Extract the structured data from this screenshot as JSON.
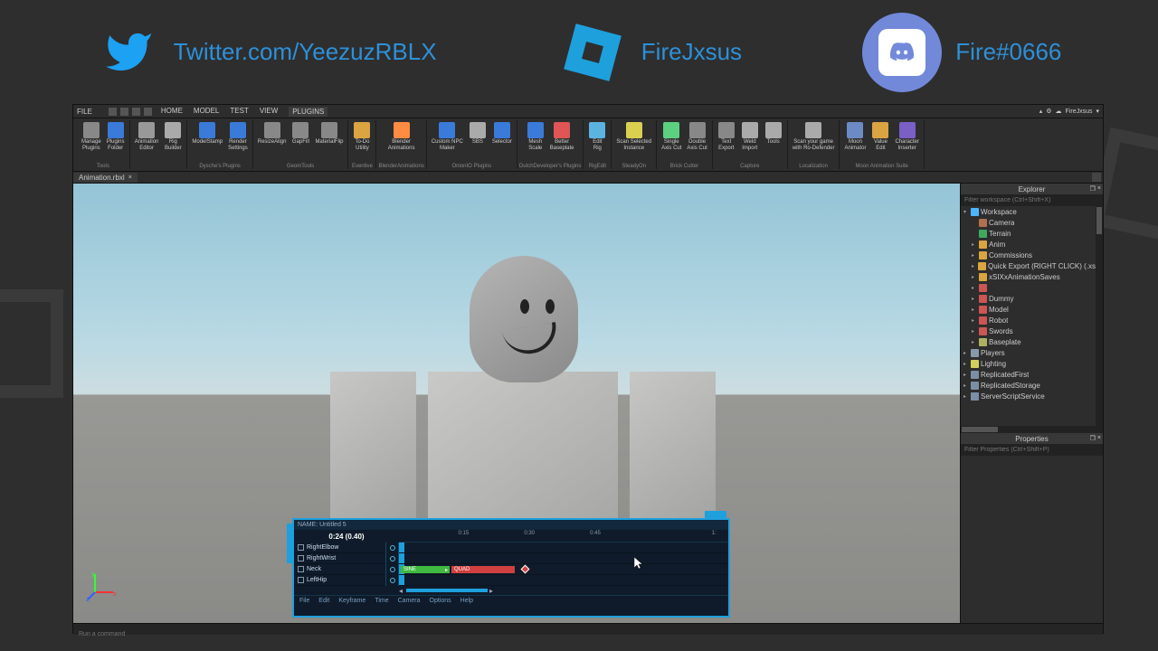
{
  "banner": {
    "twitter": "Twitter.com/YeezuzRBLX",
    "brand": "FireJxsus",
    "discord": "Fire#0666"
  },
  "menubar": {
    "file": "FILE",
    "tabs": [
      "HOME",
      "MODEL",
      "TEST",
      "VIEW",
      "PLUGINS"
    ],
    "user": "FireJxsus"
  },
  "ribbon": [
    {
      "group": "Tools",
      "items": [
        "Manage\nPlugins",
        "Plugins\nFolder"
      ]
    },
    {
      "group": "",
      "items": [
        "Animation\nEditor",
        "Rig\nBuilder"
      ]
    },
    {
      "group": "Dysche's Plugins",
      "items": [
        "ModelStamp",
        "Render\nSettings"
      ]
    },
    {
      "group": "GeomTools",
      "items": [
        "ResizeAlign",
        "GapFill",
        "MaterialFlip"
      ]
    },
    {
      "group": "Eventive",
      "items": [
        "To-Do\nUtility"
      ]
    },
    {
      "group": "BlenderAnimations",
      "items": [
        "Blender\nAnimations"
      ]
    },
    {
      "group": "OnionIO Plugins",
      "items": [
        "Custom NPC\nMaker",
        "SBS",
        "Selector"
      ]
    },
    {
      "group": "DutchDeveloper's Plugins",
      "items": [
        "Mesh\nScale",
        "Better\nBaseplate"
      ]
    },
    {
      "group": "RigEdit",
      "items": [
        "Edit\nRig"
      ]
    },
    {
      "group": "SteadyOn",
      "items": [
        "Scan Selected\nInstance"
      ]
    },
    {
      "group": "Brick Cutter",
      "items": [
        "Single\nAxis Cut",
        "Double\nAxis Cut"
      ]
    },
    {
      "group": "Capture",
      "items": [
        "Text\nExport",
        "Weld\nImport",
        "Tools"
      ]
    },
    {
      "group": "Localization",
      "items": [
        "Scan your game\nwith Ro-Defender"
      ]
    },
    {
      "group": "Moon Animation Suite",
      "items": [
        "Moon\nAnimator",
        "Value\nEdit",
        "Character\nInserter"
      ]
    }
  ],
  "document": {
    "tab": "Animation.rbxl"
  },
  "explorer": {
    "title": "Explorer",
    "filter_placeholder": "Filter workspace (Ctrl+Shift+X)",
    "tree": [
      {
        "label": "Workspace",
        "color": "#4fb4ff",
        "indent": 0,
        "arrow": "▾"
      },
      {
        "label": "Camera",
        "color": "#b07050",
        "indent": 1
      },
      {
        "label": "Terrain",
        "color": "#41a85f",
        "indent": 1
      },
      {
        "label": "Anim",
        "color": "#d9a441",
        "indent": 1,
        "arrow": "▸"
      },
      {
        "label": "Commissions",
        "color": "#d9a441",
        "indent": 1,
        "arrow": "▸"
      },
      {
        "label": "Quick Export (RIGHT CLICK) (.xslva FILE)",
        "color": "#d9a441",
        "indent": 1,
        "arrow": "▸"
      },
      {
        "label": "xSIXxAnimationSaves",
        "color": "#d9a441",
        "indent": 1,
        "arrow": "▸"
      },
      {
        "label": "",
        "color": "#cc5555",
        "indent": 1,
        "arrow": "▸"
      },
      {
        "label": "Dummy",
        "color": "#cc5555",
        "indent": 1,
        "arrow": "▸"
      },
      {
        "label": "Model",
        "color": "#cc5555",
        "indent": 1,
        "arrow": "▸"
      },
      {
        "label": "Robot",
        "color": "#cc5555",
        "indent": 1,
        "arrow": "▸"
      },
      {
        "label": "Swords",
        "color": "#cc5555",
        "indent": 1,
        "arrow": "▸"
      },
      {
        "label": "Baseplate",
        "color": "#aeb160",
        "indent": 1,
        "arrow": "▸"
      },
      {
        "label": "Players",
        "color": "#8899aa",
        "indent": 0,
        "arrow": "▸"
      },
      {
        "label": "Lighting",
        "color": "#d0d060",
        "indent": 0,
        "arrow": "▸"
      },
      {
        "label": "ReplicatedFirst",
        "color": "#7a8fa6",
        "indent": 0,
        "arrow": "▸"
      },
      {
        "label": "ReplicatedStorage",
        "color": "#7a8fa6",
        "indent": 0,
        "arrow": "▸"
      },
      {
        "label": "ServerScriptService",
        "color": "#7a8fa6",
        "indent": 0,
        "arrow": "▸"
      }
    ]
  },
  "properties": {
    "title": "Properties",
    "filter_placeholder": "Filter Properties (Ctrl+Shift+P)"
  },
  "anim": {
    "name_label": "NAME: Untitled 5",
    "time": "0:24 (0.40)",
    "ticks": [
      "0:15",
      "0:30",
      "0:45",
      "1:"
    ],
    "tracks": [
      "RightElbow",
      "RightWrist",
      "Neck",
      "LeftHip"
    ],
    "seg1": "SINE",
    "seg2": "QUAD",
    "menu": [
      "File",
      "Edit",
      "Keyframe",
      "Time",
      "Camera",
      "Options",
      "Help"
    ]
  },
  "command_placeholder": "Run a command"
}
